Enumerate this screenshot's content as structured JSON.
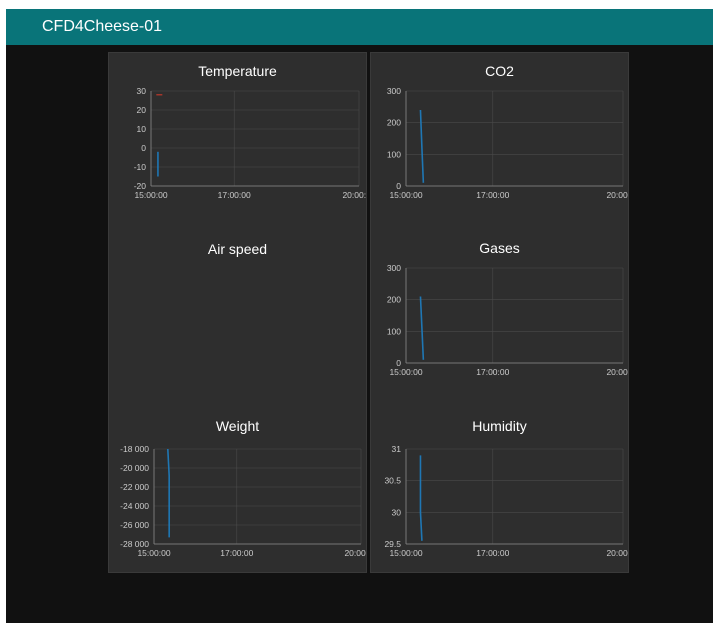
{
  "app": {
    "title": "CFD4Cheese-01"
  },
  "colors": {
    "header": "#097479",
    "background": "#111111",
    "panel": "#2e2e2e",
    "line": "#1f77b4",
    "grid": "#4a4a4a",
    "axis_text": "#cccccc"
  },
  "widgets": {
    "temperature": {
      "title": "Temperature"
    },
    "air_speed": {
      "title": "Air speed"
    },
    "weight": {
      "title": "Weight"
    },
    "co2": {
      "title": "CO2"
    },
    "gases": {
      "title": "Gases"
    },
    "humidity": {
      "title": "Humidity"
    }
  },
  "chart_data": [
    {
      "id": "temperature",
      "type": "line",
      "title": "Temperature",
      "x_ticks": [
        "15:00:00",
        "17:00:00",
        "20:00:00"
      ],
      "y_ticks": [
        "30",
        "20",
        "10",
        "0",
        "-10",
        "-20"
      ],
      "ylim": [
        -20,
        30
      ],
      "xlim": [
        "15:00:00",
        "20:00:00"
      ],
      "grid": true,
      "series": [
        {
          "color": "#1f77b4",
          "x": [
            "15:10",
            "15:10",
            "15:10"
          ],
          "y": [
            -2,
            -8,
            -15
          ]
        },
        {
          "color": "#c0392b",
          "x": [
            "15:12"
          ],
          "y": [
            28
          ]
        }
      ]
    },
    {
      "id": "co2",
      "type": "line",
      "title": "CO2",
      "x_ticks": [
        "15:00:00",
        "17:00:00",
        "20:00:00"
      ],
      "y_ticks": [
        "300",
        "200",
        "100",
        "0"
      ],
      "ylim": [
        0,
        300
      ],
      "xlim": [
        "15:00:00",
        "20:00:00"
      ],
      "grid": true,
      "series": [
        {
          "color": "#1f77b4",
          "x": [
            "15:20",
            "15:22",
            "15:24"
          ],
          "y": [
            240,
            120,
            10
          ]
        }
      ]
    },
    {
      "id": "gases",
      "type": "line",
      "title": "Gases",
      "x_ticks": [
        "15:00:00",
        "17:00:00",
        "20:00:00"
      ],
      "y_ticks": [
        "300",
        "200",
        "100",
        "0"
      ],
      "ylim": [
        0,
        300
      ],
      "xlim": [
        "15:00:00",
        "20:00:00"
      ],
      "grid": true,
      "series": [
        {
          "color": "#1f77b4",
          "x": [
            "15:20",
            "15:22",
            "15:24"
          ],
          "y": [
            210,
            110,
            10
          ]
        }
      ]
    },
    {
      "id": "weight",
      "type": "line",
      "title": "Weight",
      "x_ticks": [
        "15:00:00",
        "17:00:00",
        "20:00:00"
      ],
      "y_ticks": [
        "-18 000",
        "-20 000",
        "-22 000",
        "-24 000",
        "-26 000",
        "-28 000"
      ],
      "ylim": [
        -28000,
        -18000
      ],
      "xlim": [
        "15:00:00",
        "20:00:00"
      ],
      "grid": true,
      "series": [
        {
          "color": "#1f77b4",
          "x": [
            "15:20",
            "15:22",
            "15:22"
          ],
          "y": [
            -18000,
            -20800,
            -27300
          ]
        }
      ]
    },
    {
      "id": "humidity",
      "type": "line",
      "title": "Humidity",
      "x_ticks": [
        "15:00:00",
        "17:00:00",
        "20:00:00"
      ],
      "y_ticks": [
        "31",
        "30.5",
        "30",
        "29.5"
      ],
      "ylim": [
        29.5,
        31
      ],
      "xlim": [
        "15:00:00",
        "20:00:00"
      ],
      "grid": true,
      "series": [
        {
          "color": "#1f77b4",
          "x": [
            "15:20",
            "15:20",
            "15:22"
          ],
          "y": [
            30.9,
            30.0,
            29.55
          ]
        }
      ]
    }
  ]
}
